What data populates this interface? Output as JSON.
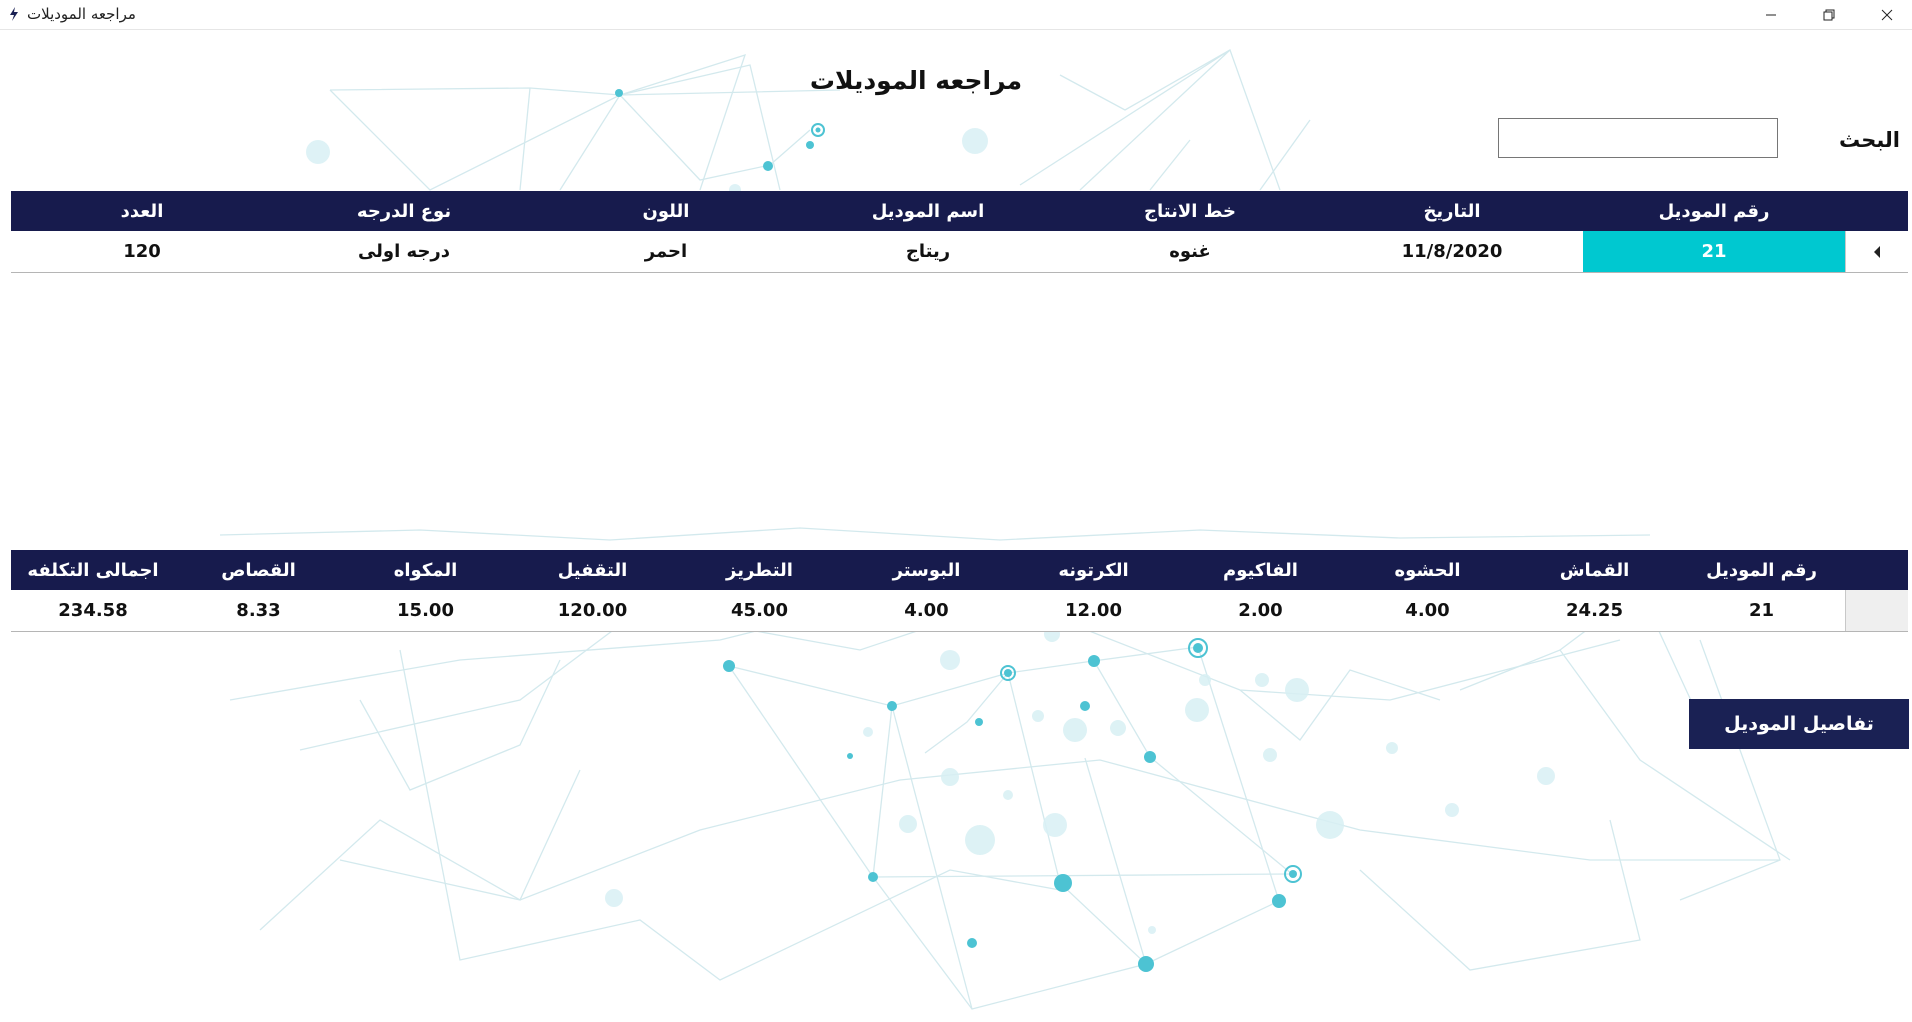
{
  "window": {
    "title": "مراجعه الموديلات",
    "icon": "app-lightning-icon",
    "controls": [
      "minimize-icon",
      "maximize-icon",
      "close-icon"
    ]
  },
  "page": {
    "title": "مراجعه الموديلات"
  },
  "search": {
    "label": "البحث",
    "value": "",
    "placeholder": ""
  },
  "models_grid": {
    "columns": [
      "رقم الموديل",
      "التاريخ",
      "خط الانتاج",
      "اسم الموديل",
      "اللون",
      "نوع الدرجه",
      "العدد"
    ],
    "rows": [
      [
        "21",
        "11/8/2020",
        "غنوه",
        "ريتاج",
        "احمر",
        "درجه اولى",
        "120"
      ]
    ],
    "row_indicator": "current-row-arrow-icon"
  },
  "costs_grid": {
    "columns": [
      "رقم الموديل",
      "القماش",
      "الحشوه",
      "الفاكيوم",
      "الكرتونه",
      "البوستر",
      "التطريز",
      "التقفيل",
      "المكواه",
      "القصاص",
      "اجمالى التكلفه"
    ],
    "rows": [
      [
        "21",
        "24.25",
        "4.00",
        "2.00",
        "12.00",
        "4.00",
        "45.00",
        "120.00",
        "15.00",
        "8.33",
        "234.58"
      ]
    ]
  },
  "actions": {
    "details_button": "تفاصيل الموديل"
  },
  "colors": {
    "header_bg": "#171b4d",
    "selected_cell": "#00c8d0",
    "button_bg": "#1a2154",
    "network_accent": "#4dc3d3"
  }
}
